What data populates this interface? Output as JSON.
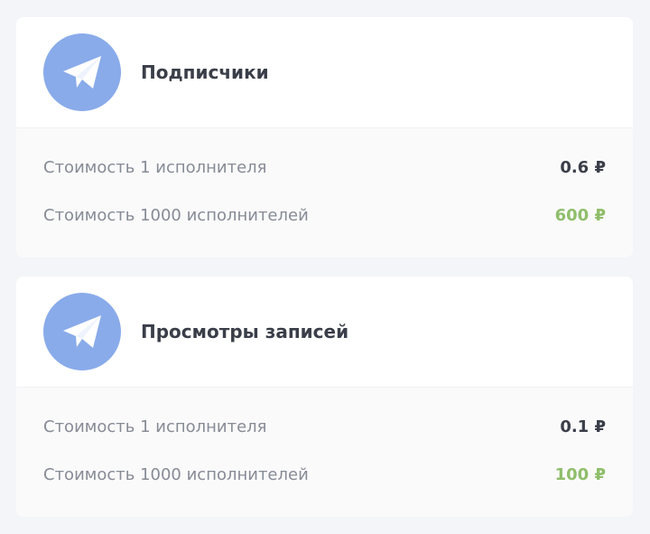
{
  "cards": [
    {
      "icon": "telegram-icon",
      "title": "Подписчики",
      "rows": [
        {
          "label": "Стоимость 1 исполнителя",
          "value": "0.6 ₽"
        },
        {
          "label": "Стоимость 1000 исполнителей",
          "value": "600 ₽"
        }
      ]
    },
    {
      "icon": "telegram-icon",
      "title": "Просмотры записей",
      "rows": [
        {
          "label": "Стоимость 1 исполнителя",
          "value": "0.1 ₽"
        },
        {
          "label": "Стоимость 1000 исполнителей",
          "value": "100 ₽"
        }
      ]
    }
  ],
  "colors": {
    "background": "#f4f5f9",
    "icon_circle": "#89abea",
    "title_text": "#3a3e48",
    "label_text": "#878b95",
    "accent_green": "#8fbe6a"
  }
}
